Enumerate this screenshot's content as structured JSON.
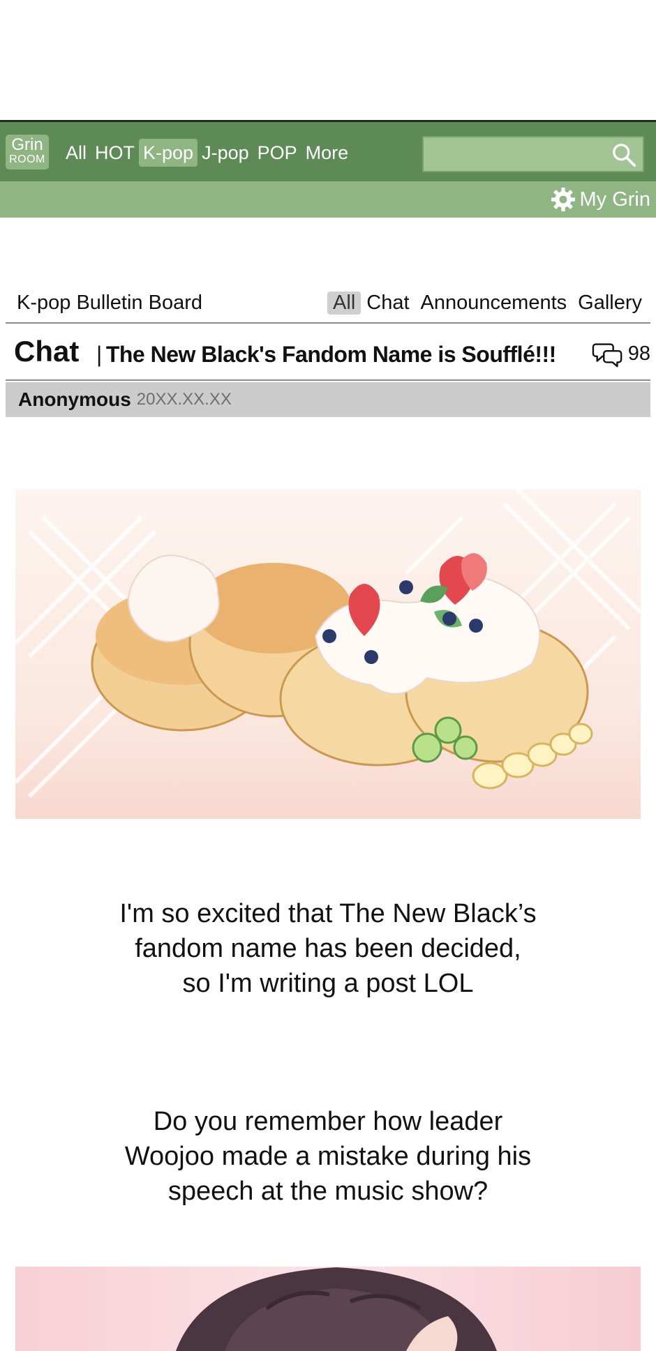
{
  "site": {
    "logo_line1": "Grin",
    "logo_line2": "ROOM"
  },
  "nav": {
    "items": [
      {
        "label": "All"
      },
      {
        "label": "HOT"
      },
      {
        "label": "K-pop",
        "active": true
      },
      {
        "label": "J-pop"
      },
      {
        "label": "POP"
      },
      {
        "label": "More"
      }
    ],
    "search_placeholder": "",
    "my_grin_label": "My Grin"
  },
  "board": {
    "title": "K-pop Bulletin Board",
    "tabs": [
      {
        "label": "All",
        "active": true
      },
      {
        "label": "Chat"
      },
      {
        "label": "Announcements"
      },
      {
        "label": "Gallery"
      }
    ]
  },
  "post": {
    "category": "Chat",
    "separator": "|",
    "title": "The New Black's Fandom Name is Soufflé!!!",
    "comment_count": "98",
    "author": "Anonymous",
    "date": "20XX.XX.XX",
    "paragraph1": [
      "I'm so excited that The New Black’s",
      "fandom name has been decided,",
      "so I'm writing a post LOL"
    ],
    "paragraph2": [
      "Do you remember how leader",
      "Woojoo made a mistake during his",
      "speech at the music show?"
    ]
  },
  "colors": {
    "nav_dark_green": "#5e8a56",
    "nav_light_green": "#8fb583",
    "author_bar_gray": "#cccccc"
  }
}
